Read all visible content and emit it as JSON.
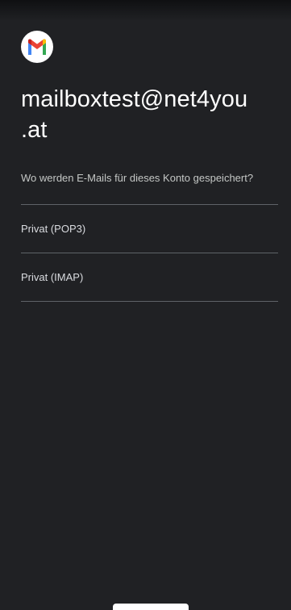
{
  "app": {
    "logo_icon": "gmail-logo-icon",
    "account_email_line1": "mailboxtest@net4you",
    "account_email_line2": ".at"
  },
  "prompt": {
    "question": "Wo werden E-Mails für dieses Konto gespeichert?"
  },
  "options": [
    {
      "label": "Privat (POP3)"
    },
    {
      "label": "Privat (IMAP)"
    }
  ],
  "colors": {
    "background": "#202124",
    "divider": "#5f6368",
    "gmail_red": "#ea4335",
    "gmail_blue": "#4285f4",
    "gmail_green": "#34a853",
    "gmail_yellow": "#fbbc04"
  }
}
